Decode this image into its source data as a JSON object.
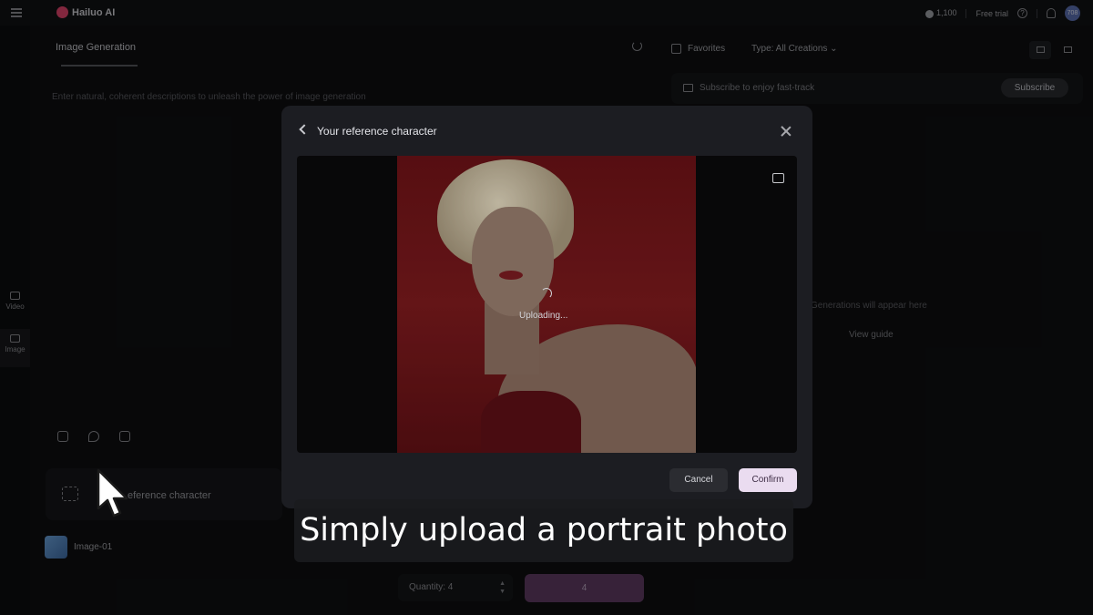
{
  "topbar": {
    "brand": "Hailuo AI",
    "credits": "1,100",
    "free_trial": "Free trial",
    "avatar_initials": "708"
  },
  "sidebar": {
    "items": [
      {
        "label": "Video"
      },
      {
        "label": "Image"
      }
    ]
  },
  "left_panel": {
    "tab_title": "Image Generation",
    "prompt_placeholder": "Enter natural, coherent descriptions to unleash the power of image generation",
    "ref_label": "eference character",
    "image_row_label": "Image-01",
    "quantity_label": "Quantity: 4",
    "generate_cost": "4"
  },
  "right_panel": {
    "favorites_label": "Favorites",
    "type_filter": "Type:  All Creations",
    "subscribe_text": "Subscribe to enjoy fast-track",
    "subscribe_button": "Subscribe",
    "empty_text": "Generations will appear here",
    "guide_link": "View guide"
  },
  "modal": {
    "title": "Your reference character",
    "status": "Uploading...",
    "cancel_label": "Cancel",
    "confirm_label": "Confirm"
  },
  "caption": "Simply upload a portrait photo"
}
